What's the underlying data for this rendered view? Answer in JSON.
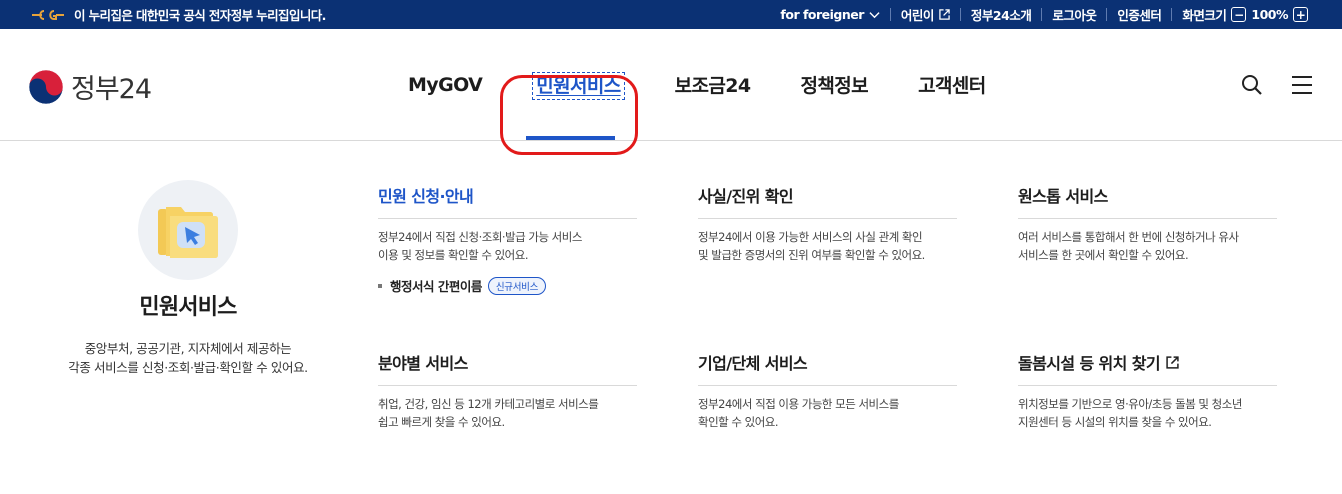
{
  "topbar": {
    "notice": "이 누리집은 대한민국 공식 전자정부 누리집입니다.",
    "foreigner": "for foreigner",
    "kids": "어린이",
    "about": "정부24소개",
    "logout": "로그아웃",
    "cert": "인증센터",
    "screen_size": "화면크기",
    "zoom_minus": "−",
    "zoom_level": "100%",
    "zoom_plus": "+"
  },
  "header": {
    "logo_text": "정부24",
    "nav": {
      "mygov": "MyGOV",
      "minwon": "민원서비스",
      "bojo": "보조금24",
      "policy": "정책정보",
      "support": "고객센터"
    }
  },
  "mega": {
    "intro_title": "민원서비스",
    "intro_desc_1": "중앙부처, 공공기관, 지자체에서 제공하는",
    "intro_desc_2": "각종 서비스를 신청·조회·발급·확인할 수 있어요.",
    "columns": [
      {
        "title": "민원 신청·안내",
        "desc_1": "정부24에서 직접 신청·조회·발급 가능 서비스",
        "desc_2": "이용 및 정보를 확인할 수 있어요.",
        "sub_link": "행정서식 간편이름",
        "badge": "신규서비스"
      },
      {
        "title": "사실/진위 확인",
        "desc_1": "정부24에서 이용 가능한 서비스의 사실 관계 확인",
        "desc_2": "및 발급한 증명서의 진위 여부를 확인할 수 있어요."
      },
      {
        "title": "원스톱 서비스",
        "desc_1": "여러 서비스를 통합해서 한 번에 신청하거나 유사",
        "desc_2": "서비스를 한 곳에서 확인할 수 있어요."
      },
      {
        "title": "분야별 서비스",
        "desc_1": "취업, 건강, 임신 등 12개 카테고리별로 서비스를",
        "desc_2": "쉽고 빠르게 찾을 수 있어요."
      },
      {
        "title": "기업/단체 서비스",
        "desc_1": "정부24에서 직접 이용 가능한 모든 서비스를",
        "desc_2": "확인할 수 있어요."
      },
      {
        "title": "돌봄시설 등 위치 찾기",
        "desc_1": "위치정보를 기반으로 영·유아/초등 돌봄 및 청소년",
        "desc_2": "지원센터 등 시설의 위치를 찾을 수 있어요."
      }
    ]
  },
  "colors": {
    "topbar_bg": "#0b3174",
    "accent_blue": "#1e55c8",
    "highlight_red": "#e21a1a"
  },
  "icons": {
    "gov_mark": "eg-government-mark-icon",
    "chevron": "chevron-down-icon",
    "external": "external-link-icon",
    "search": "search-icon",
    "menu": "hamburger-menu-icon",
    "emblem": "taegeuk-emblem-icon",
    "illustration": "folder-cursor-icon"
  }
}
